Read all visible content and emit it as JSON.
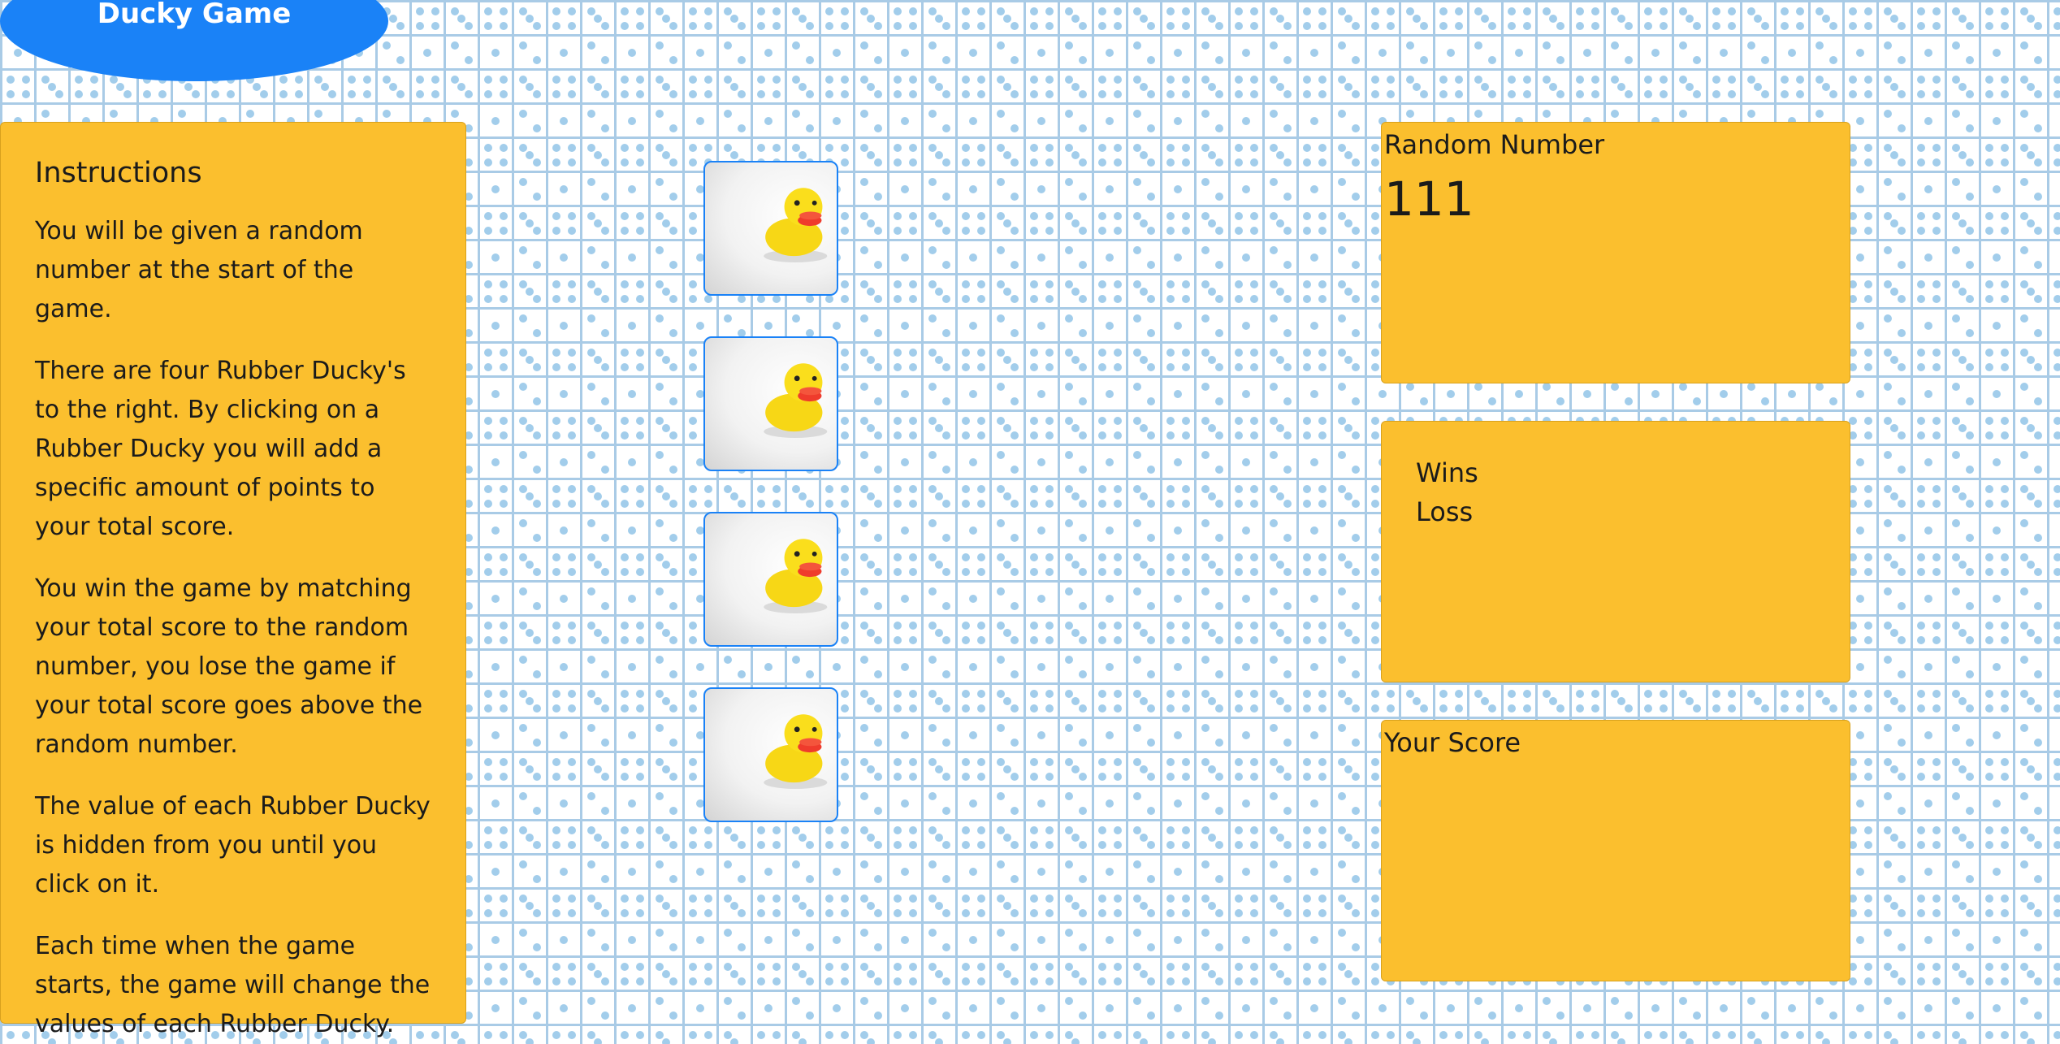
{
  "header": {
    "title": "Ducky Game"
  },
  "instructions": {
    "heading": "Instructions",
    "paragraphs": [
      "You will be given a random number at the start of the game.",
      "There are four Rubber Ducky's to the right. By clicking on a Rubber Ducky you will add a specific amount of points to your total score.",
      "You win the game by matching your total score to the random number, you lose the game if your total score goes above the random number.",
      "The value of each Rubber Ducky is hidden from you until you click on it.",
      "Each time when the game starts, the game will change the values of each Rubber Ducky."
    ]
  },
  "duckies": [
    {
      "icon": "rubber-duck-icon"
    },
    {
      "icon": "rubber-duck-icon"
    },
    {
      "icon": "rubber-duck-icon"
    },
    {
      "icon": "rubber-duck-icon"
    }
  ],
  "random": {
    "label": "Random Number",
    "value": "111"
  },
  "record": {
    "wins_label": "Wins",
    "loss_label": "Loss"
  },
  "score": {
    "label": "Your Score"
  },
  "colors": {
    "accent": "#1a82f7",
    "panel": "#fbbf2e",
    "grid_line": "#a9cbe6",
    "dot": "#a2cdeb"
  }
}
